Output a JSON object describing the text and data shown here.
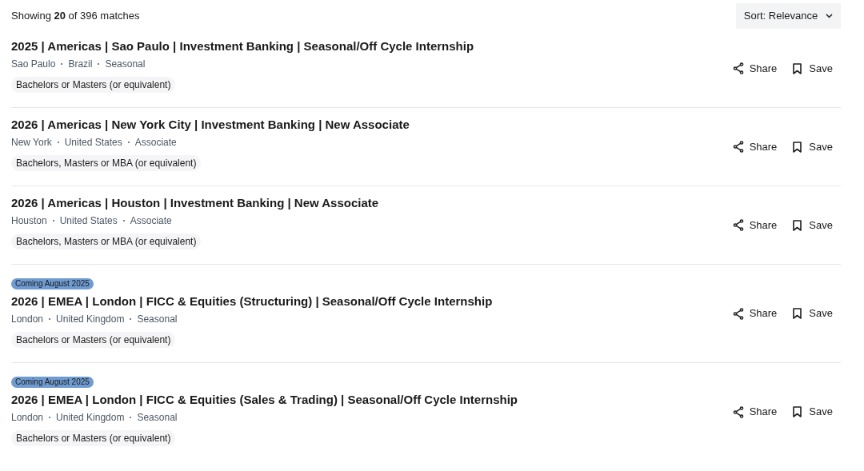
{
  "summary": "Showing **20** of 396 matches",
  "sort": {
    "label": "Sort: Relevance"
  },
  "jobs": [
    {
      "title": "2025 | Americas | Sao Paulo | Investment Banking | Seasonal/Off Cycle Internship",
      "meta": [
        "Sao Paulo",
        "Brazil",
        "Seasonal"
      ],
      "degree": "Bachelors or Masters (or equivalent)",
      "share": "Share",
      "save": "Save"
    },
    {
      "title": "2026 | Americas | New York City | Investment Banking | New Associate",
      "meta": [
        "New York",
        "United States",
        "Associate"
      ],
      "degree": "Bachelors, Masters or MBA (or equivalent)",
      "share": "Share",
      "save": "Save"
    },
    {
      "title": "2026 | Americas | Houston | Investment Banking | New Associate",
      "meta": [
        "Houston",
        "United States",
        "Associate"
      ],
      "degree": "Bachelors, Masters or MBA (or equivalent)",
      "share": "Share",
      "save": "Save"
    },
    {
      "badge": "Coming August 2025",
      "title": "2026 | EMEA | London | FICC & Equities (Structuring) | Seasonal/Off Cycle Internship",
      "meta": [
        "London",
        "United Kingdom",
        "Seasonal"
      ],
      "degree": "Bachelors or Masters (or equivalent)",
      "share": "Share",
      "save": "Save"
    },
    {
      "badge": "Coming August 2025",
      "title": "2026 | EMEA | London | FICC & Equities (Sales & Trading) | Seasonal/Off Cycle Internship",
      "meta": [
        "London",
        "United Kingdom",
        "Seasonal"
      ],
      "degree": "Bachelors or Masters (or equivalent)",
      "share": "Share",
      "save": "Save"
    }
  ]
}
